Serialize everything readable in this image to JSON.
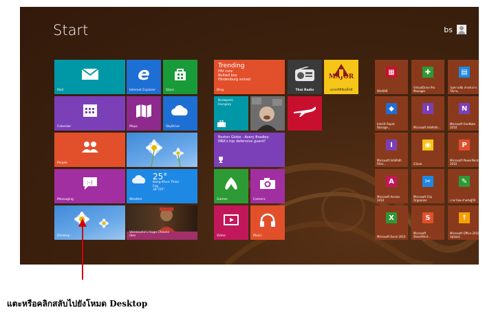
{
  "screen": {
    "title": "Start",
    "user_name": "bs"
  },
  "tiles": {
    "mail": "Mail",
    "internet_explorer": "Internet Explorer",
    "store": "Store",
    "trending_title": "Trending",
    "trending_lines": [
      "HIV cure",
      "Bullied boy",
      "Hindenburg solved"
    ],
    "bing": "Bing",
    "thai_radio": "Thai Radio",
    "major_logo": "MAJOR",
    "major_label": "เมเจอร์ซีนีเพล็กซ์",
    "calendar": "Calendar",
    "maps": "Maps",
    "skydrive": "SkyDrive",
    "travel_title": "Budapest, Hungary",
    "people": "People",
    "news_text": "Boston Globe - Avery Bradley: NBA's top defensive guard?",
    "messaging": "Messaging",
    "weather_temp": "25°",
    "weather_place": "Bang Khun Thian",
    "weather_cond": "Fog",
    "weather_range": "34°/25°",
    "weather": "Weather",
    "games": "Games",
    "camera": "Camera",
    "desktop": "Desktop",
    "venezuela": "Venezuela's Hugo Chavez dies",
    "video": "Video",
    "music": "Music"
  },
  "small_tiles": [
    {
      "label": "WinRAR",
      "color": "#8a3a1c"
    },
    {
      "label": "VirtualDrive Pro Manager",
      "color": "#8a3a1c"
    },
    {
      "label": "ไม่ทราบชื่อ สำหรับการใช้งาน",
      "color": "#8a3a1c"
    },
    {
      "label": "Intel® Rapid Storage...",
      "color": "#8a3a1c"
    },
    {
      "label": "Microsoft InfoPath...",
      "color": "#8a3a1c"
    },
    {
      "label": "Microsoft OneNote 2010",
      "color": "#8a3a1c"
    },
    {
      "label": "Microsoft InfoPath Filler...",
      "color": "#8a3a1c"
    },
    {
      "label": "iClone",
      "color": "#8a3a1c"
    },
    {
      "label": "Microsoft PowerPoint 2010",
      "color": "#8a3a1c"
    },
    {
      "label": "Microsoft Access 2010",
      "color": "#8a3a1c"
    },
    {
      "label": "Microsoft Clip Organizer",
      "color": "#8a3a1c"
    },
    {
      "label": "ภาษาไทย สำหรับผู้ใช้",
      "color": "#8a3a1c"
    },
    {
      "label": "Microsoft Excel 2010",
      "color": "#8a3a1c"
    },
    {
      "label": "Microsoft SharePoint...",
      "color": "#8a3a1c"
    },
    {
      "label": "Microsoft Office 2010 Upload...",
      "color": "#8a3a1c"
    }
  ],
  "caption": "แตะหรือคลิกสลับไปยังโหมด Desktop",
  "colors": {
    "mail": "#0097a7",
    "ie": "#1e6fd4",
    "store": "#1a9b3a",
    "bing": "#e2502b",
    "calendar": "#7b3fb8",
    "maps": "#8e2a8e",
    "skydrive": "#1e6fd4",
    "people": "#e2502b",
    "news": "#7b3fb8",
    "messaging": "#a12fa1",
    "weather": "#1e88e5",
    "games": "#2e9a35",
    "camera": "#a12fa1",
    "video": "#c2185b",
    "music": "#e2502b",
    "arrow": "#d40000"
  }
}
